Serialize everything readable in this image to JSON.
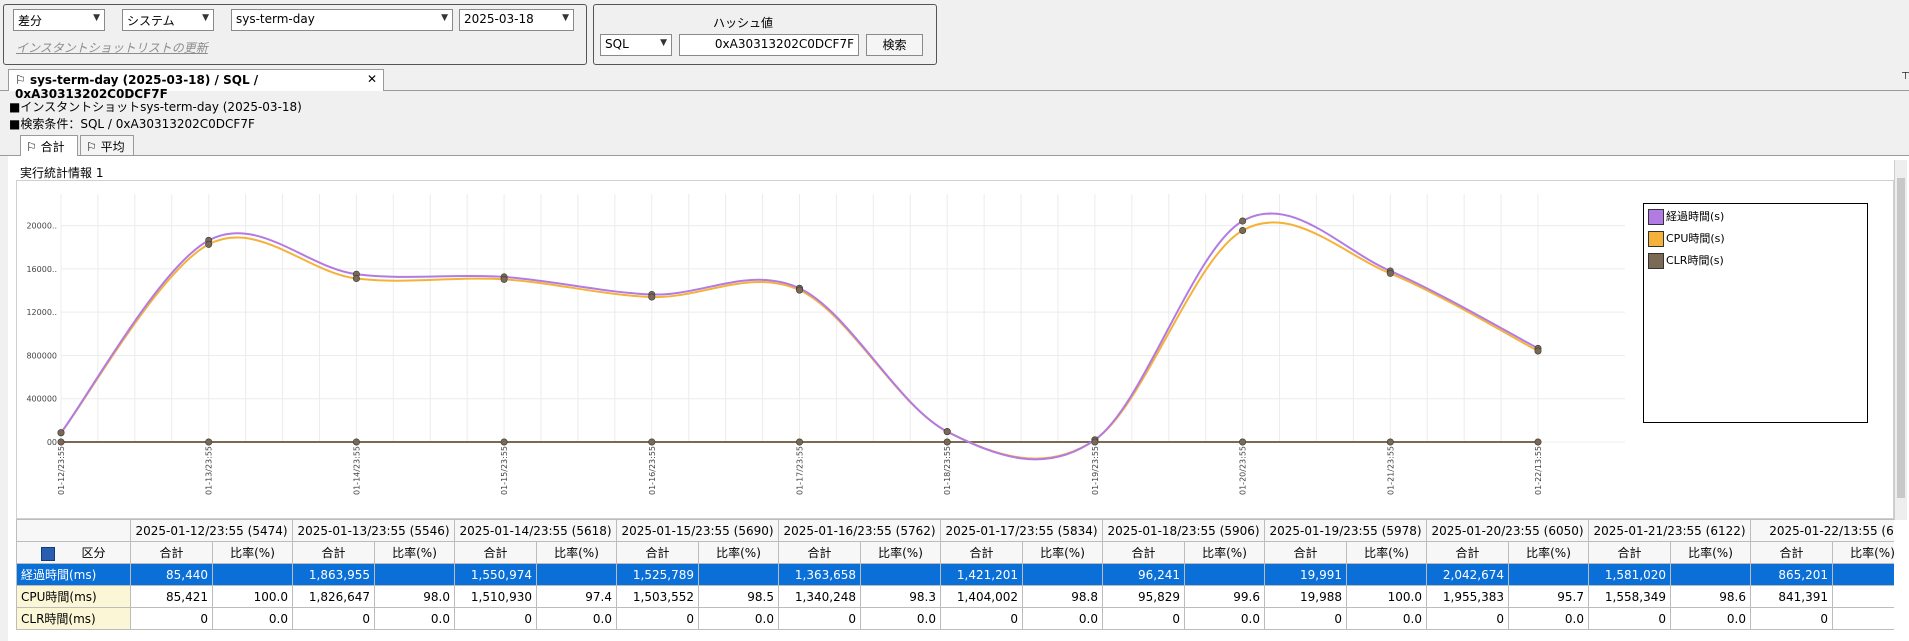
{
  "toolbar": {
    "mode": "差分",
    "target": "システム",
    "snapshot": "sys-term-day",
    "date": "2025-03-18",
    "refresh_link": "インスタントショットリストの更新",
    "hash_label": "ハッシュ値",
    "kind": "SQL",
    "hash_value": "0xA30313202C0DCF7F",
    "search_button": "検索"
  },
  "doc_tab": {
    "label": "sys-term-day (2025-03-18) / SQL / 0xA30313202C0DCF7F"
  },
  "info": {
    "line1": "■インスタントショットsys-term-day (2025-03-18)",
    "line2": "■検索条件：SQL / 0xA30313202C0DCF7F"
  },
  "subtabs": [
    {
      "label": "合計"
    },
    {
      "label": "平均"
    }
  ],
  "section_title": "実行統計情報 1",
  "colors": {
    "elapsed": "#b27ae3",
    "cpu": "#f5b23a",
    "clr": "#7a6a55",
    "selection": "#0a6fd6"
  },
  "chart_data": {
    "type": "line",
    "x": [
      "01-12/23:55",
      "01-13/23:55",
      "01-14/23:55",
      "01-15/23:55",
      "01-16/23:55",
      "01-17/23:55",
      "01-18/23:55",
      "01-19/23:55",
      "01-20/23:55",
      "01-21/23:55",
      "01-22/13:55"
    ],
    "ytick_labels": [
      "00",
      "400000",
      "800000",
      "12000..",
      "16000..",
      "20000.."
    ],
    "ylim": [
      0,
      2200000
    ],
    "grid": true,
    "legend_position": "right",
    "series": [
      {
        "name": "経過時間(s)",
        "values": [
          85440,
          1863955,
          1550974,
          1525789,
          1363658,
          1421201,
          96241,
          19991,
          2042674,
          1581020,
          865201
        ]
      },
      {
        "name": "CPU時間(s)",
        "values": [
          85421,
          1826647,
          1510930,
          1503552,
          1340248,
          1404002,
          95829,
          19988,
          1955383,
          1558349,
          841391
        ]
      },
      {
        "name": "CLR時間(s)",
        "values": [
          0,
          0,
          0,
          0,
          0,
          0,
          0,
          0,
          0,
          0,
          0
        ]
      }
    ]
  },
  "table": {
    "group_headers": [
      "2025-01-12/23:55 (5474)",
      "2025-01-13/23:55 (5546)",
      "2025-01-14/23:55 (5618)",
      "2025-01-15/23:55 (5690)",
      "2025-01-16/23:55 (5762)",
      "2025-01-17/23:55 (5834)",
      "2025-01-18/23:55 (5906)",
      "2025-01-19/23:55 (5978)",
      "2025-01-20/23:55 (6050)",
      "2025-01-21/23:55 (6122)",
      "2025-01-22/13:55 (6"
    ],
    "category_header": "区分",
    "sub_total": "合計",
    "sub_ratio": "比率(%)",
    "rows": [
      {
        "label": "経過時間(ms)",
        "cells": [
          "85,440",
          "",
          "1,863,955",
          "",
          "1,550,974",
          "",
          "1,525,789",
          "",
          "1,363,658",
          "",
          "1,421,201",
          "",
          "96,241",
          "",
          "19,991",
          "",
          "2,042,674",
          "",
          "1,581,020",
          "",
          "865,201",
          ""
        ]
      },
      {
        "label": "CPU時間(ms)",
        "cells": [
          "85,421",
          "100.0",
          "1,826,647",
          "98.0",
          "1,510,930",
          "97.4",
          "1,503,552",
          "98.5",
          "1,340,248",
          "98.3",
          "1,404,002",
          "98.8",
          "95,829",
          "99.6",
          "19,988",
          "100.0",
          "1,955,383",
          "95.7",
          "1,558,349",
          "98.6",
          "841,391",
          ""
        ]
      },
      {
        "label": "CLR時間(ms)",
        "cells": [
          "0",
          "0.0",
          "0",
          "0.0",
          "0",
          "0.0",
          "0",
          "0.0",
          "0",
          "0.0",
          "0",
          "0.0",
          "0",
          "0.0",
          "0",
          "0.0",
          "0",
          "0.0",
          "0",
          "0.0",
          "0",
          ""
        ]
      }
    ]
  }
}
